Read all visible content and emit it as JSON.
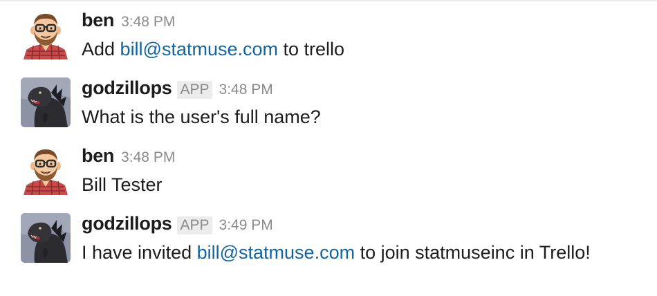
{
  "messages": [
    {
      "author": "ben",
      "avatar": "bearded-man-glasses-avatar",
      "is_app": false,
      "time": "3:48 PM",
      "text_before": "Add ",
      "link": "bill@statmuse.com",
      "text_after": " to trello"
    },
    {
      "author": "godzillops",
      "avatar": "godzilla-avatar",
      "is_app": true,
      "app_badge": "APP",
      "time": "3:48 PM",
      "text": "What is the user's full name?"
    },
    {
      "author": "ben",
      "avatar": "bearded-man-glasses-avatar",
      "is_app": false,
      "time": "3:48 PM",
      "text": "Bill Tester"
    },
    {
      "author": "godzillops",
      "avatar": "godzilla-avatar",
      "is_app": true,
      "app_badge": "APP",
      "time": "3:49 PM",
      "text_before": "I have invited ",
      "link": "bill@statmuse.com",
      "text_after": " to join statmuseinc in Trello!"
    }
  ],
  "colors": {
    "link": "#1264a3",
    "author": "#1d1c1d",
    "meta": "#8a8a8a",
    "badge_bg": "#ececec"
  }
}
